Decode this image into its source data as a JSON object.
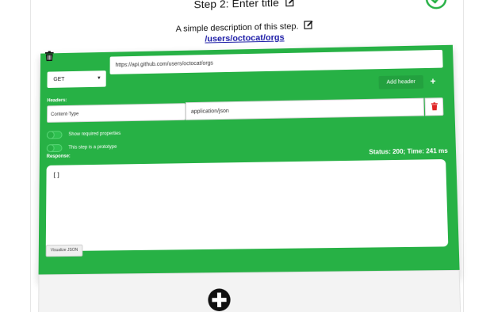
{
  "step": {
    "title": "Step 2: Enter title",
    "description": "A simple description of this step.",
    "url_link": "/users/octocat/orgs"
  },
  "request": {
    "method": "GET",
    "url": "https://api.github.com/users/octocat/orgs",
    "add_header_label": "Add header",
    "add_header_plus": "+",
    "headers_label": "Headers:",
    "headers": [
      {
        "name": "Content-Type",
        "value": "application/json"
      }
    ]
  },
  "options": {
    "show_required_label": "Show required properties",
    "prototype_label": "This step is a prototype"
  },
  "response": {
    "label": "Response:",
    "status": "Status: 200; Time: 241 ms",
    "body": "[]",
    "visualize_label": "Visualize JSON"
  },
  "colors": {
    "panel_green": "#27b145",
    "link_blue": "#1a1aa6",
    "delete_red": "#e02424"
  },
  "icons": {
    "edit": "edit-icon",
    "check": "check-circle-icon",
    "trash": "trash-icon",
    "add_step": "plus-circle-icon"
  }
}
